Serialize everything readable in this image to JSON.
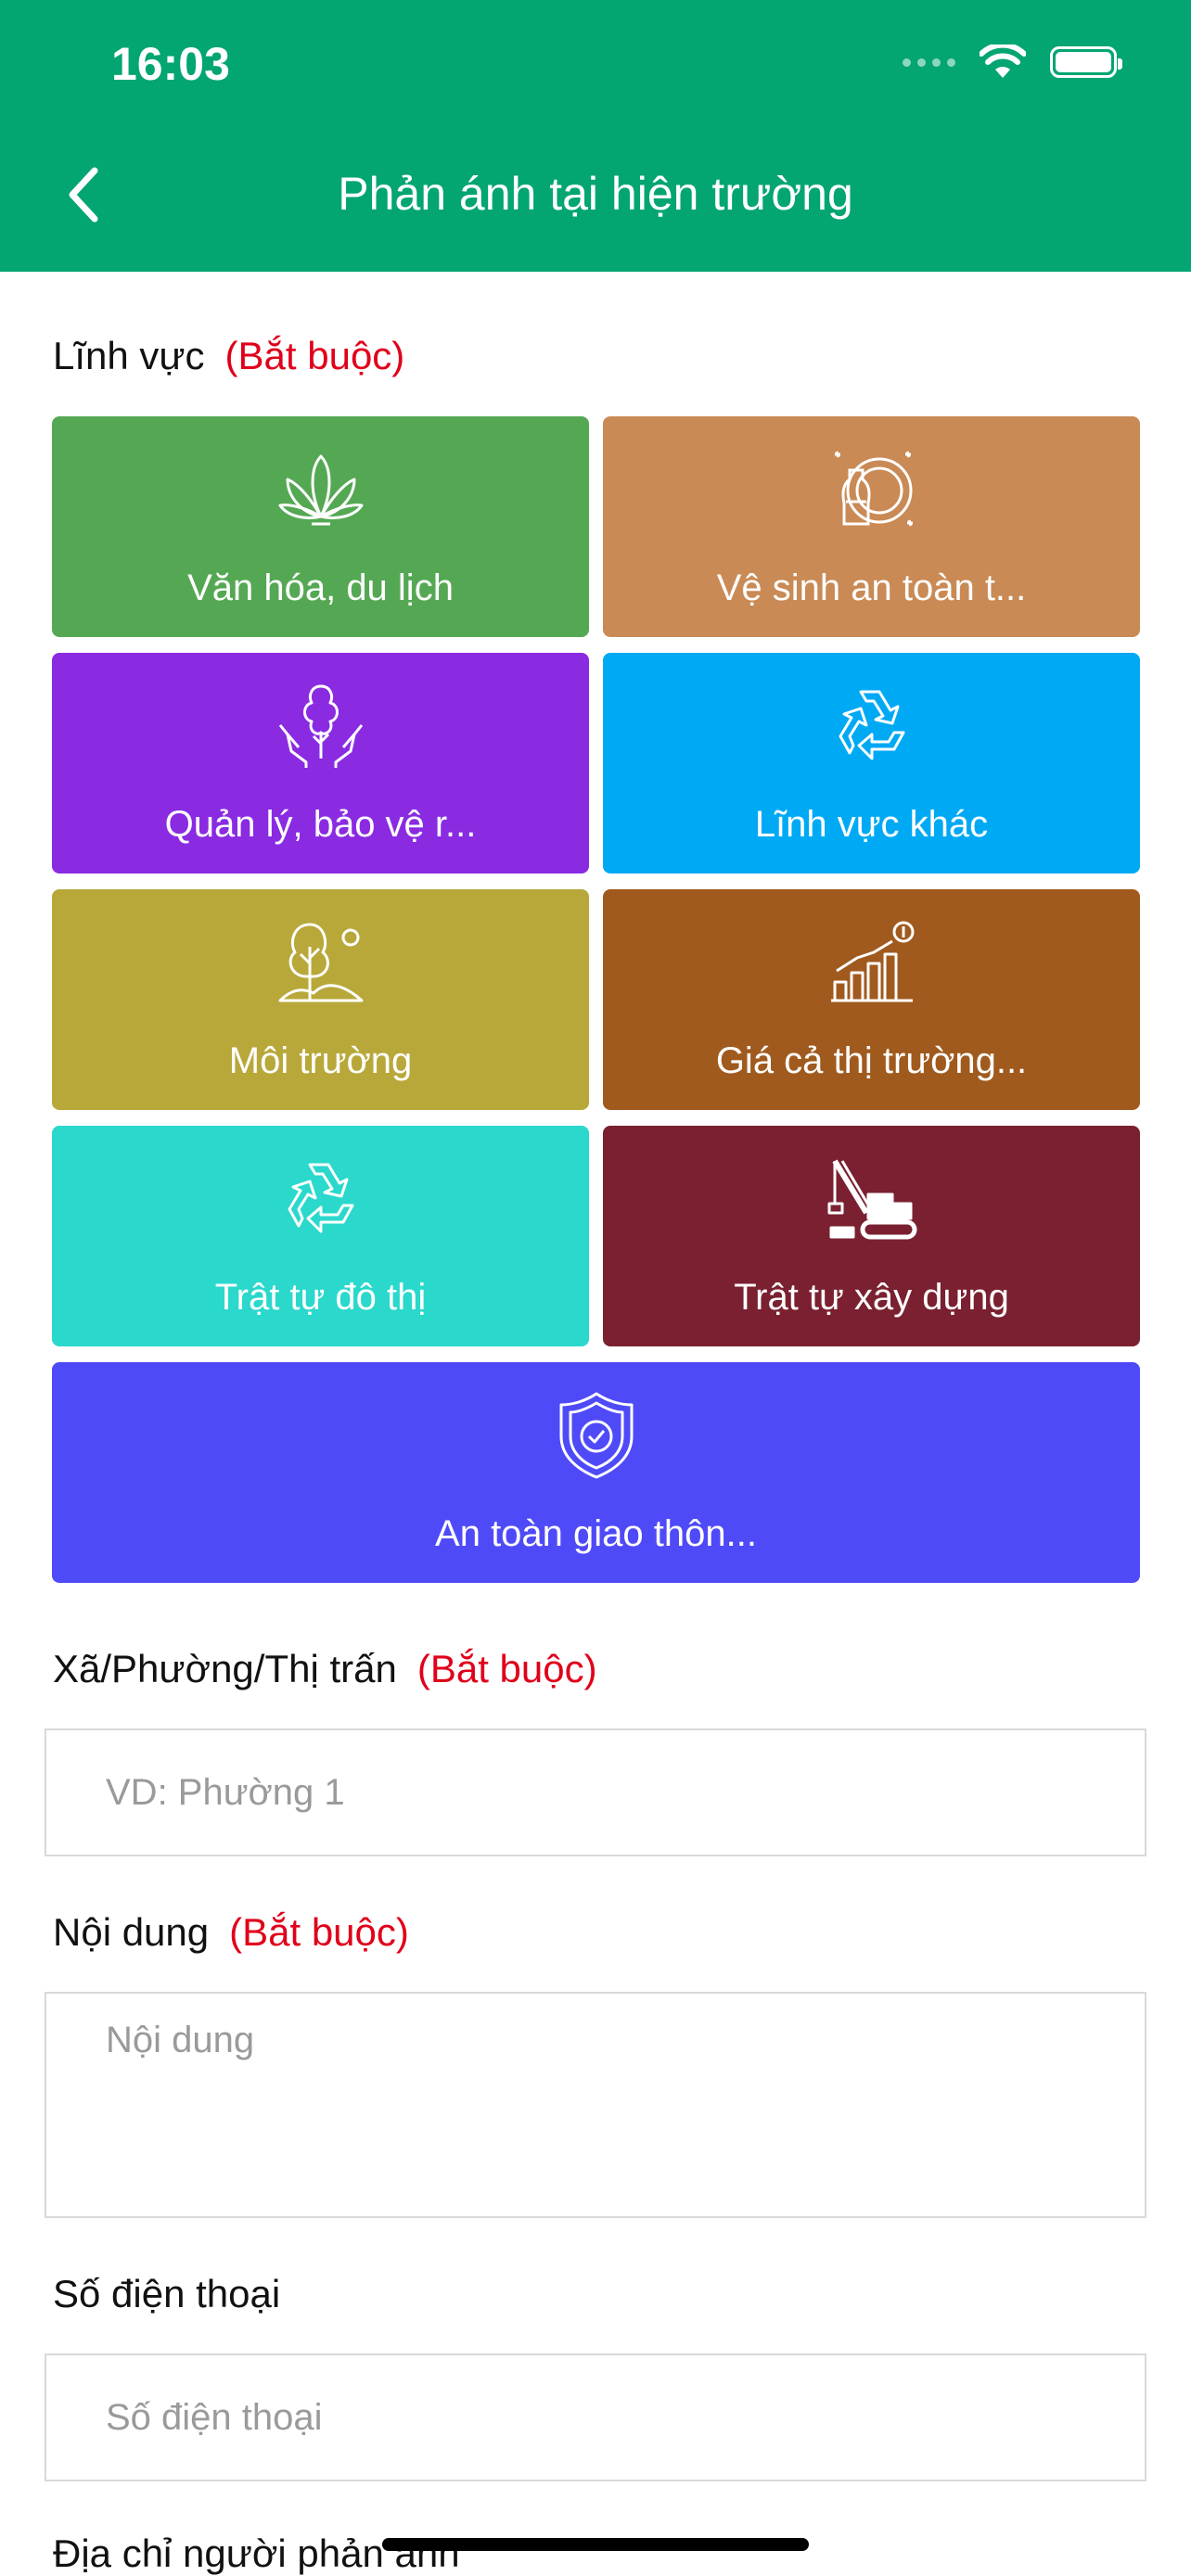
{
  "status_bar": {
    "time": "16:03"
  },
  "header": {
    "title": "Phản ánh tại hiện trường"
  },
  "linh_vuc": {
    "label": "Lĩnh vực",
    "required": "(Bắt buộc)",
    "tiles": [
      {
        "label": "Văn hóa, du lịch",
        "icon": "lotus-icon",
        "color": "#55a853"
      },
      {
        "label": "Vệ sinh an toàn t...",
        "icon": "food-safety-icon",
        "color": "#c98a55"
      },
      {
        "label": "Quản lý, bảo vệ r...",
        "icon": "forest-protection-icon",
        "color": "#8a2be2"
      },
      {
        "label": "Lĩnh vực khác",
        "icon": "recycle-icon",
        "color": "#00a9f4"
      },
      {
        "label": "Môi trường",
        "icon": "environment-tree-icon",
        "color": "#b8a83a"
      },
      {
        "label": "Giá cả thị trường...",
        "icon": "market-price-chart-icon",
        "color": "#a05a1d"
      },
      {
        "label": "Trật tự đô thị",
        "icon": "recycle-icon",
        "color": "#2ad8cc"
      },
      {
        "label": "Trật tự xây dựng",
        "icon": "crane-icon",
        "color": "#7a2030"
      },
      {
        "label": "An toàn giao thôn...",
        "icon": "shield-check-icon",
        "color": "#4f4af8"
      }
    ]
  },
  "xa_phuong": {
    "label": "Xã/Phường/Thị trấn",
    "required": "(Bắt buộc)",
    "placeholder": "VD: Phường 1"
  },
  "noi_dung": {
    "label": "Nội dung",
    "required": "(Bắt buộc)",
    "placeholder": "Nội dung"
  },
  "so_dien_thoai": {
    "label": "Số điện thoại",
    "placeholder": "Số điện thoại"
  },
  "dia_chi": {
    "label": "Địa chỉ người phản ánh"
  }
}
